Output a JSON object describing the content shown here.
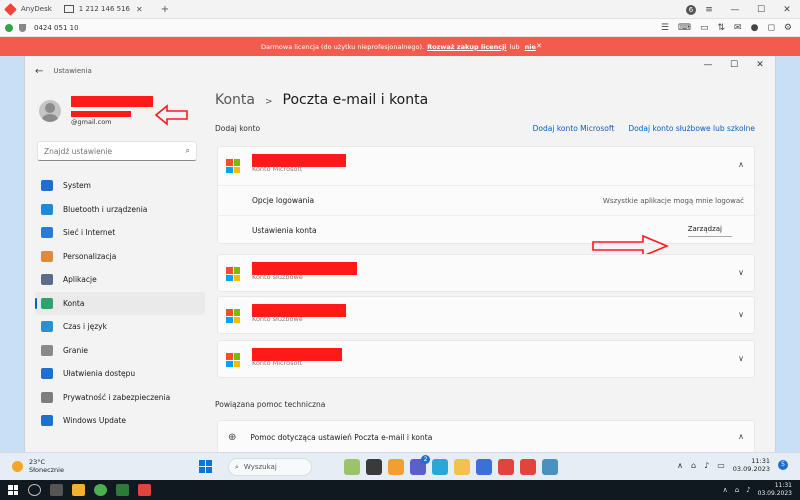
{
  "anydesk": {
    "app_tab": "AnyDesk",
    "session_tab": "1 212 146 516",
    "session_id": "0424 051 10",
    "license_text": "Darmowa licencja (do użytku nieprofesjonalnego).",
    "license_link": "Rozważ zakup licencji",
    "license_tail": "lub",
    "license_tail2": "nie",
    "badge": "6"
  },
  "window": {
    "app_title": "Ustawienia"
  },
  "user": {
    "email_suffix": "@gmail.com"
  },
  "search": {
    "placeholder": "Znajdź ustawienie"
  },
  "nav": {
    "items": [
      {
        "label": "System",
        "color": "#1f6fd0"
      },
      {
        "label": "Bluetooth i urządzenia",
        "color": "#1f8ad8"
      },
      {
        "label": "Sieć i Internet",
        "color": "#2a7bd6"
      },
      {
        "label": "Personalizacja",
        "color": "#e08a3c"
      },
      {
        "label": "Aplikacje",
        "color": "#5a6b8c"
      },
      {
        "label": "Konta",
        "color": "#2fa36b"
      },
      {
        "label": "Czas i język",
        "color": "#2b8fd0"
      },
      {
        "label": "Granie",
        "color": "#8a8a8a"
      },
      {
        "label": "Ułatwienia dostępu",
        "color": "#1f6fd0"
      },
      {
        "label": "Prywatność i zabezpieczenia",
        "color": "#7d7d7d"
      },
      {
        "label": "Windows Update",
        "color": "#1f6fd0"
      }
    ],
    "active_index": 5
  },
  "breadcrumb": {
    "parent": "Konta",
    "current": "Poczta e-mail i konta"
  },
  "add_accounts": {
    "label": "Dodaj konto",
    "link1": "Dodaj konto Microsoft",
    "link2": "Dodaj konto służbowe lub szkolne"
  },
  "accounts": [
    {
      "type": "Konto Microsoft",
      "expanded": true
    },
    {
      "type": "Konto służbowe"
    },
    {
      "type": "Konto służbowe"
    },
    {
      "type": "Konto Microsoft"
    }
  ],
  "expanded": {
    "login_label": "Opcje logowania",
    "login_value": "Wszystkie aplikacje mogą mnie logować",
    "settings_label": "Ustawienia konta",
    "manage_label": "Zarządzaj"
  },
  "related": {
    "label": "Powiązana pomoc techniczna",
    "help_item": "Pomoc dotycząca ustawień Poczta e-mail i konta"
  },
  "rtaskbar": {
    "temp": "23°C",
    "weather": "Słonecznie",
    "search_placeholder": "Wyszukaj",
    "time": "11:31",
    "date": "03.09.2023",
    "notif_count": "5",
    "mail_badge": "2"
  },
  "ltaskbar": {
    "time": "11:31",
    "date": "03.09.2023"
  },
  "colors": {
    "accent": "#0067c0",
    "license_bar": "#f25c4f",
    "redaction": "#ff1a1a"
  }
}
